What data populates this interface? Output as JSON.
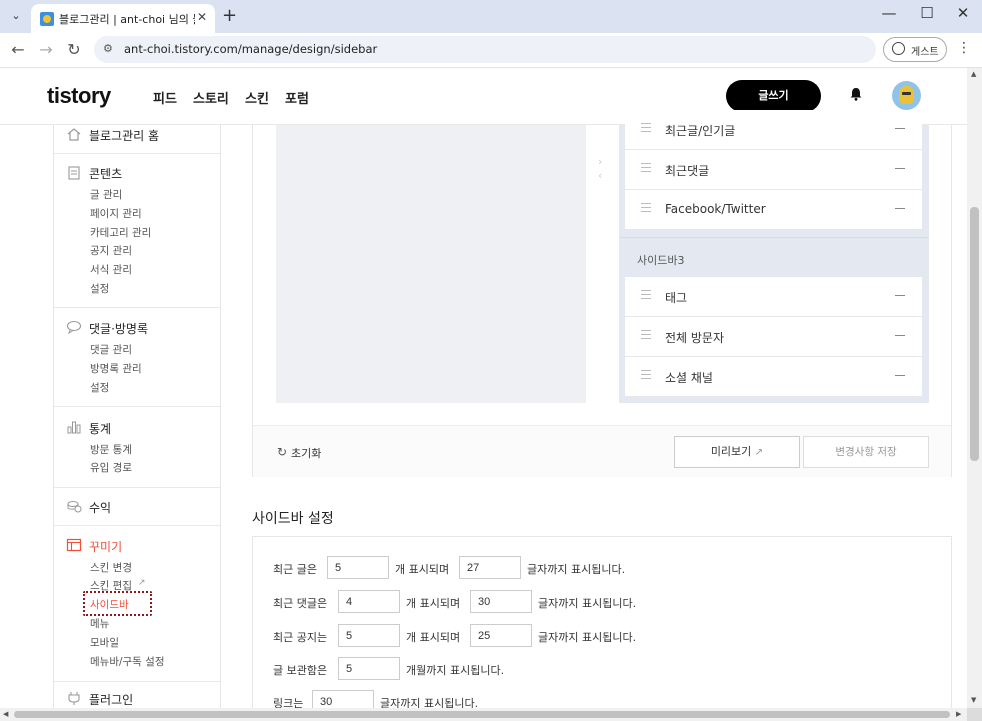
{
  "browser": {
    "tab_title": "블로그관리 | ant-choi 님의 블로그",
    "tab_search_icon": "chevron-down",
    "new_tab": "+",
    "url": "ant-choi.tistory.com/manage/design/sidebar",
    "guest_label": "게스트",
    "window_controls": {
      "minimize": "—",
      "maximize": "☐",
      "close": "✕"
    },
    "nav": {
      "back": "←",
      "forward": "→",
      "reload": "↻"
    }
  },
  "header": {
    "logo": "tistory",
    "menu": [
      "피드",
      "스토리",
      "스킨",
      "포럼"
    ],
    "write_label": "글쓰기"
  },
  "nav": {
    "home": "블로그관리 홈",
    "sections": [
      {
        "title": "콘텐츠",
        "icon": "document-icon",
        "items": [
          "글 관리",
          "페이지 관리",
          "카테고리 관리",
          "공지 관리",
          "서식 관리",
          "설정"
        ]
      },
      {
        "title": "댓글·방명록",
        "icon": "speech-bubble-icon",
        "items": [
          "댓글 관리",
          "방명록 관리",
          "설정"
        ]
      },
      {
        "title": "통계",
        "icon": "bar-chart-icon",
        "items": [
          "방문 통계",
          "유입 경로"
        ]
      },
      {
        "title": "수익",
        "icon": "coins-icon",
        "items": []
      },
      {
        "title": "꾸미기",
        "icon": "layout-icon",
        "items": [
          "스킨 변경",
          "스킨 편집",
          "사이드바",
          "메뉴",
          "모바일",
          "메뉴바/구독 설정"
        ]
      },
      {
        "title": "플러그인",
        "icon": "plug-icon",
        "items": []
      }
    ],
    "active_color": "#f04f3a"
  },
  "editor": {
    "group2_modules": [
      "최근글/인기글",
      "최근댓글",
      "Facebook/Twitter"
    ],
    "group3_title": "사이드바3",
    "group3_modules": [
      "태그",
      "전체 방문자",
      "소셜 채널"
    ],
    "reset_label": "초기화",
    "preview_label": "미리보기",
    "save_label": "변경사항 저장"
  },
  "settings": {
    "title": "사이드바 설정",
    "rows": [
      {
        "prefix": "최근 글은",
        "count": "5",
        "mid": "개 표시되며",
        "chars": "27",
        "suffix": "글자까지 표시됩니다."
      },
      {
        "prefix": "최근 댓글은",
        "count": "4",
        "mid": "개 표시되며",
        "chars": "30",
        "suffix": "글자까지 표시됩니다."
      },
      {
        "prefix": "최근 공지는",
        "count": "5",
        "mid": "개 표시되며",
        "chars": "25",
        "suffix": "글자까지 표시됩니다."
      },
      {
        "prefix": "글 보관함은",
        "count": "5",
        "suffix": "개월까지 표시됩니다."
      },
      {
        "prefix": "링크는",
        "count": "30",
        "suffix": "글자까지 표시됩니다."
      }
    ]
  }
}
